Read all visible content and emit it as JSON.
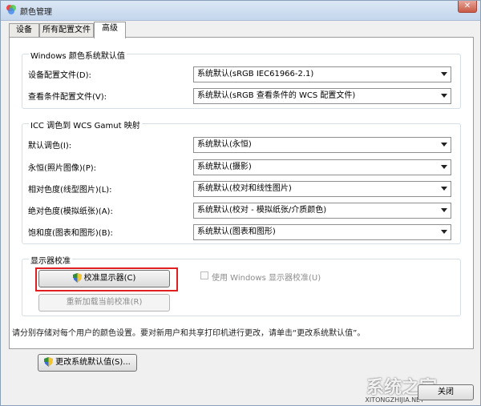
{
  "window": {
    "title": "颜色管理",
    "close_glyph": "✕"
  },
  "tabs": [
    {
      "label": "设备"
    },
    {
      "label": "所有配置文件"
    },
    {
      "label": "高级"
    }
  ],
  "defaults_group": {
    "title": "Windows 颜色系统默认值",
    "rows": [
      {
        "label": "设备配置文件(D):",
        "value": "系统默认(sRGB IEC61966-2.1)"
      },
      {
        "label": "查看条件配置文件(V):",
        "value": "系统默认(sRGB 查看条件的 WCS 配置文件)"
      }
    ]
  },
  "gamut_group": {
    "title": "ICC 调色到 WCS Gamut 映射",
    "rows": [
      {
        "label": "默认调色(I):",
        "value": "系统默认(永恒)"
      },
      {
        "label": "永恒(照片图像)(P):",
        "value": "系统默认(摄影)"
      },
      {
        "label": "相对色度(线型图片)(L):",
        "value": "系统默认(校对和线性图片)"
      },
      {
        "label": "绝对色度(模拟纸张)(A):",
        "value": "系统默认(校对 - 模拟纸张/介质颜色)"
      },
      {
        "label": "饱和度(图表和图形)(B):",
        "value": "系统默认(图表和图形)"
      }
    ]
  },
  "calibration_group": {
    "title": "显示器校准",
    "calibrate_button": "校准显示器(C)",
    "reload_button": "重新加载当前校准(R)",
    "use_windows_calibration": "使用 Windows 显示器校准(U)"
  },
  "info_text": "请分别存储对每个用户的颜色设置。要对新用户和共享打印机进行更改，请单击“更改系统默认值”。",
  "change_defaults_button": "更改系统默认值(S)...",
  "close_button": "关闭",
  "watermark": {
    "main": "系统之家",
    "sub": "XITONGZHIJIA.NET"
  },
  "colors": {
    "highlight": "#e02020",
    "title_bar": "#c4d6ec"
  }
}
